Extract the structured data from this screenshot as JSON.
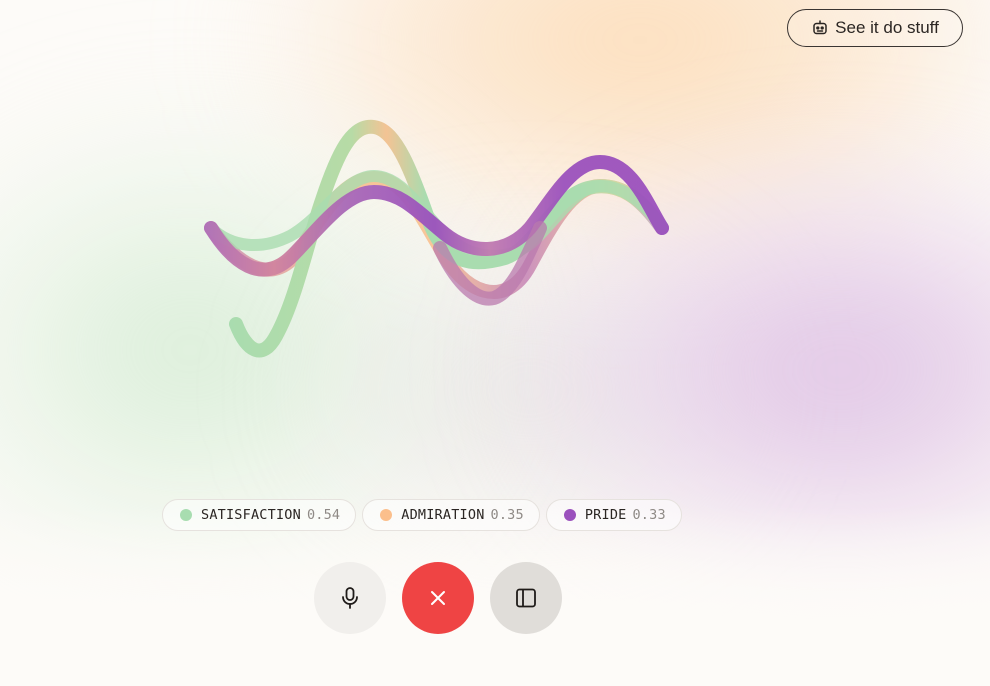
{
  "top_button": {
    "label": "See it do stuff",
    "icon": "robot-icon"
  },
  "emotions": [
    {
      "name": "SATISFACTION",
      "score": "0.54",
      "color": "#a8ddb0"
    },
    {
      "name": "ADMIRATION",
      "score": "0.35",
      "color": "#fbbf8c"
    },
    {
      "name": "PRIDE",
      "score": "0.33",
      "color": "#9b51bd"
    }
  ],
  "controls": {
    "mic_icon": "microphone-icon",
    "end_icon": "close-icon",
    "panel_icon": "sidebar-panel-icon",
    "end_color": "#ef4444"
  },
  "colors": {
    "satisfaction": "#a8ddb0",
    "admiration": "#fbbf8c",
    "pride": "#9b51bd"
  }
}
